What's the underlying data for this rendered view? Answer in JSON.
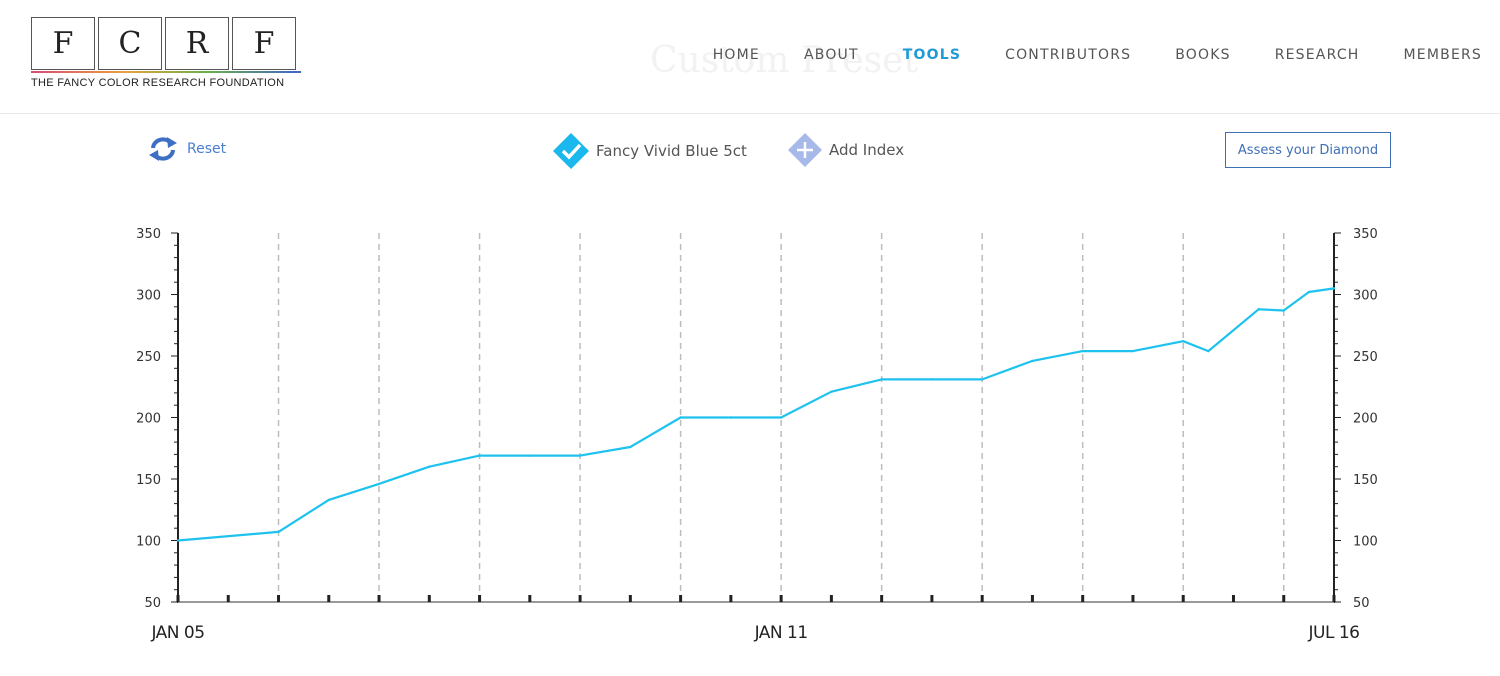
{
  "logo": {
    "letters": [
      "F",
      "C",
      "R",
      "F"
    ],
    "subtitle": "THE FANCY COLOR RESEARCH FOUNDATION"
  },
  "page_title": "Custom Preset",
  "nav": {
    "items": [
      {
        "label": "HOME",
        "active": false
      },
      {
        "label": "ABOUT",
        "active": false
      },
      {
        "label": "TOOLS",
        "active": true
      },
      {
        "label": "CONTRIBUTORS",
        "active": false
      },
      {
        "label": "BOOKS",
        "active": false
      },
      {
        "label": "RESEARCH",
        "active": false
      },
      {
        "label": "MEMBERS",
        "active": false
      }
    ]
  },
  "toolbar": {
    "reset_label": "Reset",
    "series_label": "Fancy Vivid Blue 5ct",
    "add_index_label": "Add Index",
    "assess_label": "Assess your Diamond"
  },
  "colors": {
    "accent": "#1f9ad6",
    "series_line": "#1ec2ee",
    "series_chip": "#1ab8ec",
    "add_index_chip": "#a7b9e8",
    "button_border": "#3f6fb5",
    "grid": "#bdbdbd",
    "axis": "#222222"
  },
  "icons": {
    "reset": "refresh-arrows-icon",
    "series": "checkmark-diamond-icon",
    "add_index": "plus-diamond-icon"
  },
  "chart_data": {
    "type": "line",
    "x_tick_labels": [
      {
        "label": "JAN 05",
        "x": 0
      },
      {
        "label": "JAN 11",
        "x": 12
      },
      {
        "label": "JUL 16",
        "x": 23
      }
    ],
    "ylim": [
      50,
      350
    ],
    "yticks": [
      50,
      100,
      150,
      200,
      250,
      300,
      350
    ],
    "left_axis": true,
    "right_axis": true,
    "vertical_dashed_grid": true,
    "xlim": [
      0,
      23
    ],
    "dashed_grid_x": [
      2,
      4,
      6,
      8,
      10,
      12,
      14,
      16,
      18,
      20,
      22
    ],
    "series": [
      {
        "color": "#1ec2ee",
        "points": [
          [
            0,
            100
          ],
          [
            2,
            107
          ],
          [
            3,
            133
          ],
          [
            4,
            146
          ],
          [
            5,
            160
          ],
          [
            6,
            169
          ],
          [
            7,
            169
          ],
          [
            8,
            169
          ],
          [
            9,
            176
          ],
          [
            10,
            200
          ],
          [
            11,
            200
          ],
          [
            12,
            200
          ],
          [
            13,
            221
          ],
          [
            14,
            231
          ],
          [
            15,
            231
          ],
          [
            16,
            231
          ],
          [
            17,
            246
          ],
          [
            18,
            254
          ],
          [
            19,
            254
          ],
          [
            20,
            262
          ],
          [
            20.5,
            254
          ],
          [
            21.5,
            288
          ],
          [
            22,
            287
          ],
          [
            22.5,
            302
          ],
          [
            23,
            305
          ]
        ]
      }
    ]
  }
}
